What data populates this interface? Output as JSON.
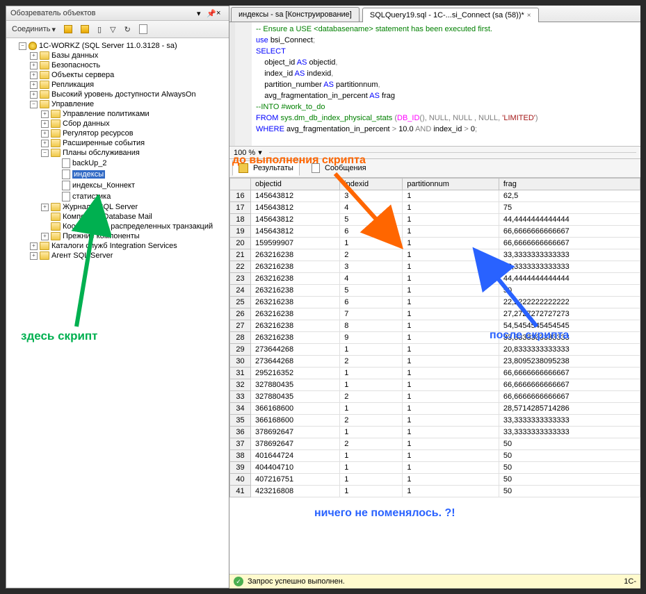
{
  "panel": {
    "title": "Обозреватель объектов",
    "connect_label": "Соединить"
  },
  "tree": {
    "server": "1C-WORKZ (SQL Server 11.0.3128 - sa)",
    "nodes": {
      "databases": "Базы данных",
      "security": "Безопасность",
      "server_objects": "Объекты сервера",
      "replication": "Репликация",
      "alwayson": "Высокий уровень доступности AlwaysOn",
      "management": "Управление",
      "policy": "Управление политиками",
      "data_collection": "Сбор данных",
      "resource_gov": "Регулятор ресурсов",
      "ext_events": "Расширенные события",
      "maint_plans": "Планы обслуживания",
      "backup2": "backUp_2",
      "indexes": "индексы",
      "indexes_connect": "индексы_Коннект",
      "stats": "статистика",
      "sql_logs": "Журналы SQL Server",
      "db_mail": "Компонент Database Mail",
      "dtc": "Координатор распределенных транзакций",
      "old_comp": "Прежние компоненты",
      "ssis": "Каталоги служб Integration Services",
      "agent": "Агент SQL Server"
    }
  },
  "tabs": {
    "tab1": "индексы - sa [Конструирование]",
    "tab2": "SQLQuery19.sql - 1C-...si_Connect (sa (58))*"
  },
  "sql": {
    "comment1": "-- Ensure a USE <databasename> statement has been executed first.",
    "use": "use",
    "db": "bsi_Connect",
    "select": "SELECT",
    "col1": "object_id",
    "col2": "index_id",
    "col3": "partition_number",
    "col4": "avg_fragmentation_in_percent",
    "as": "AS",
    "alias1": "objectid",
    "alias2": "indexid",
    "alias3": "partitionnum",
    "alias4": "frag",
    "into_comment": "--INTO #work_to_do",
    "from": "FROM",
    "dmv": "sys.dm_db_index_physical_stats",
    "dbid": "DB_ID",
    "null": "NULL",
    "limited": "'LIMITED'",
    "where": "WHERE",
    "gt": ">",
    "val10": "10.0",
    "and": "AND",
    "indexid_cond": "index_id",
    "val0": "0"
  },
  "zoom": "100 %",
  "results": {
    "results_tab": "Результаты",
    "messages_tab": "Сообщения",
    "cols": [
      "objectid",
      "indexid",
      "partitionnum",
      "frag"
    ]
  },
  "rows": [
    {
      "n": "16",
      "c": [
        "145643812",
        "3",
        "1",
        "62,5"
      ]
    },
    {
      "n": "17",
      "c": [
        "145643812",
        "4",
        "1",
        "75"
      ]
    },
    {
      "n": "18",
      "c": [
        "145643812",
        "5",
        "1",
        "44,4444444444444"
      ]
    },
    {
      "n": "19",
      "c": [
        "145643812",
        "6",
        "1",
        "66,6666666666667"
      ]
    },
    {
      "n": "20",
      "c": [
        "159599907",
        "1",
        "1",
        "66,6666666666667"
      ]
    },
    {
      "n": "21",
      "c": [
        "263216238",
        "2",
        "1",
        "33,3333333333333"
      ]
    },
    {
      "n": "22",
      "c": [
        "263216238",
        "3",
        "1",
        "33,3333333333333"
      ]
    },
    {
      "n": "23",
      "c": [
        "263216238",
        "4",
        "1",
        "44,4444444444444"
      ]
    },
    {
      "n": "24",
      "c": [
        "263216238",
        "5",
        "1",
        "50"
      ]
    },
    {
      "n": "25",
      "c": [
        "263216238",
        "6",
        "1",
        "22,2222222222222"
      ]
    },
    {
      "n": "26",
      "c": [
        "263216238",
        "7",
        "1",
        "27,2727272727273"
      ]
    },
    {
      "n": "27",
      "c": [
        "263216238",
        "8",
        "1",
        "54,5454545454545"
      ]
    },
    {
      "n": "28",
      "c": [
        "263216238",
        "9",
        "1",
        "33,3333333333333"
      ]
    },
    {
      "n": "29",
      "c": [
        "273644268",
        "1",
        "1",
        "20,8333333333333"
      ]
    },
    {
      "n": "30",
      "c": [
        "273644268",
        "2",
        "1",
        "23,8095238095238"
      ]
    },
    {
      "n": "31",
      "c": [
        "295216352",
        "1",
        "1",
        "66,6666666666667"
      ]
    },
    {
      "n": "32",
      "c": [
        "327880435",
        "1",
        "1",
        "66,6666666666667"
      ]
    },
    {
      "n": "33",
      "c": [
        "327880435",
        "2",
        "1",
        "66,6666666666667"
      ]
    },
    {
      "n": "34",
      "c": [
        "366168600",
        "1",
        "1",
        "28,5714285714286"
      ]
    },
    {
      "n": "35",
      "c": [
        "366168600",
        "2",
        "1",
        "33,3333333333333"
      ]
    },
    {
      "n": "36",
      "c": [
        "378692647",
        "1",
        "1",
        "33,3333333333333"
      ]
    },
    {
      "n": "37",
      "c": [
        "378692647",
        "2",
        "1",
        "50"
      ]
    },
    {
      "n": "38",
      "c": [
        "401644724",
        "1",
        "1",
        "50"
      ]
    },
    {
      "n": "39",
      "c": [
        "404404710",
        "1",
        "1",
        "50"
      ]
    },
    {
      "n": "40",
      "c": [
        "407216751",
        "1",
        "1",
        "50"
      ]
    },
    {
      "n": "41",
      "c": [
        "423216808",
        "1",
        "1",
        "50"
      ]
    }
  ],
  "status": "Запрос успешно выполнен.",
  "status_server_label": "1C-",
  "annotations": {
    "before_script": "до выполнения скрипта",
    "after_script": "после скрипта",
    "here_script": "здесь скрипт",
    "nothing_changed": "ничего не поменялось. ?!"
  }
}
